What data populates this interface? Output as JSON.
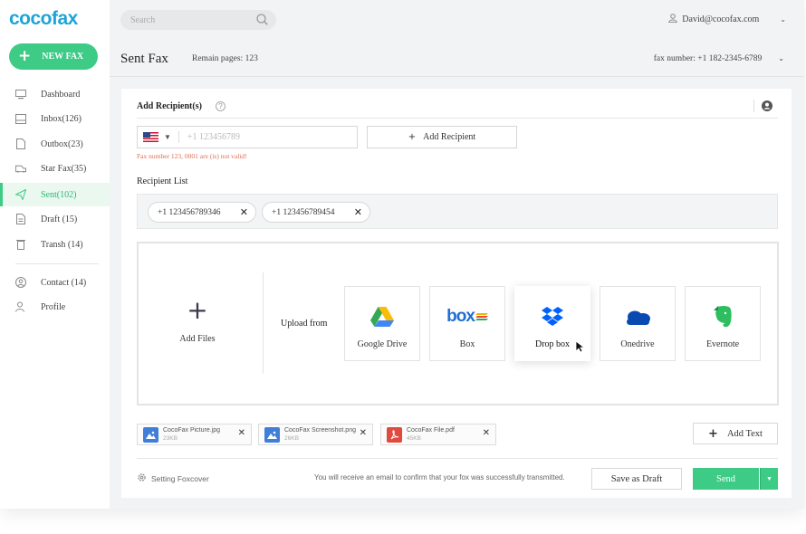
{
  "app": {
    "logo": "cocofax",
    "new_fax_label": "NEW FAX"
  },
  "sidebar": {
    "items": [
      {
        "label": "Dashboard",
        "icon": "monitor-icon"
      },
      {
        "label": "Inbox(126)",
        "icon": "inbox-icon"
      },
      {
        "label": "Outbox(23)",
        "icon": "outbox-icon"
      },
      {
        "label": "Star Fax(35)",
        "icon": "star-fax-icon"
      },
      {
        "label": "Sent(102)",
        "icon": "send-icon",
        "active": true
      },
      {
        "label": "Draft (15)",
        "icon": "draft-icon"
      },
      {
        "label": "Transh (14)",
        "icon": "trash-icon"
      },
      {
        "label": "Contact (14)",
        "icon": "contact-icon"
      },
      {
        "label": "Profile",
        "icon": "profile-icon"
      }
    ]
  },
  "topbar": {
    "search_placeholder": "Search",
    "user_email": "David@cocofax.com"
  },
  "header": {
    "title": "Sent Fax",
    "remain": "Remain pages: 123",
    "fax_number": "fax number: +1 182-2345-6789"
  },
  "recipient": {
    "label": "Add Recipient(s)",
    "help": "?",
    "phone_placeholder": "+1 123456789",
    "add_button": "Add Recipient",
    "error": "Fax number 123, 0001 are (is) not valid!"
  },
  "recipient_list": {
    "label": "Recipient List",
    "chips": [
      "+1 123456789346",
      "+1 123456789454"
    ]
  },
  "upload": {
    "add_files": "Add Files",
    "upload_from": "Upload from",
    "services": [
      {
        "label": "Google Drive",
        "icon": "google-drive-icon"
      },
      {
        "label": "Box",
        "icon": "box-icon"
      },
      {
        "label": "Drop box",
        "icon": "dropbox-icon"
      },
      {
        "label": "Onedrive",
        "icon": "onedrive-icon"
      },
      {
        "label": "Evernote",
        "icon": "evernote-icon"
      }
    ]
  },
  "files": [
    {
      "name": "CocoFax Picture.jpg",
      "size": "23KB",
      "icon": "image-file-icon"
    },
    {
      "name": "CocoFax Screenshot.png",
      "size": "26KB",
      "icon": "image-file-icon"
    },
    {
      "name": "CocoFax File.pdf",
      "size": "45KB",
      "icon": "pdf-file-icon"
    }
  ],
  "actions": {
    "add_text": "Add Text",
    "setting_foxcover": "Setting Foxcover",
    "notice": "You will receive an email to confirm that your fox was successfully transmitted.",
    "save_draft": "Save as Draft",
    "send": "Send"
  },
  "colors": {
    "accent": "#3dcb86",
    "brand": "#1ea4d8",
    "error": "#e06c55"
  }
}
